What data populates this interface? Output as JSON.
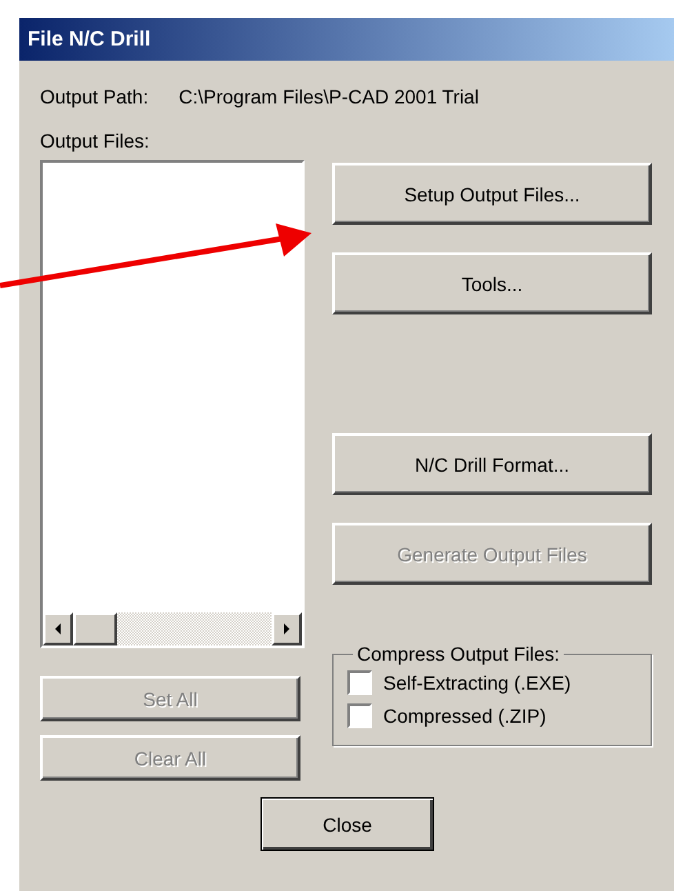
{
  "window": {
    "title": "File N/C Drill"
  },
  "output_path": {
    "label": "Output Path:",
    "value": "C:\\Program Files\\P-CAD 2001 Trial"
  },
  "output_files": {
    "label": "Output Files:"
  },
  "list_buttons": [
    {
      "label": "Set All",
      "disabled": true
    },
    {
      "label": "Clear All",
      "disabled": true
    }
  ],
  "setup_buttons": [
    {
      "label": "Setup Output Files...",
      "disabled": false
    },
    {
      "label": "Tools...",
      "disabled": false
    }
  ],
  "output_buttons": [
    {
      "label": "N/C Drill Format...",
      "disabled": false
    },
    {
      "label": "Generate Output Files",
      "disabled": true
    }
  ],
  "compress": {
    "title": "Compress Output Files:",
    "options": [
      {
        "label": "Self-Extracting (.EXE)",
        "checked": false
      },
      {
        "label": "Compressed (.ZIP)",
        "checked": false
      }
    ]
  },
  "close_button": {
    "label": "Close"
  }
}
